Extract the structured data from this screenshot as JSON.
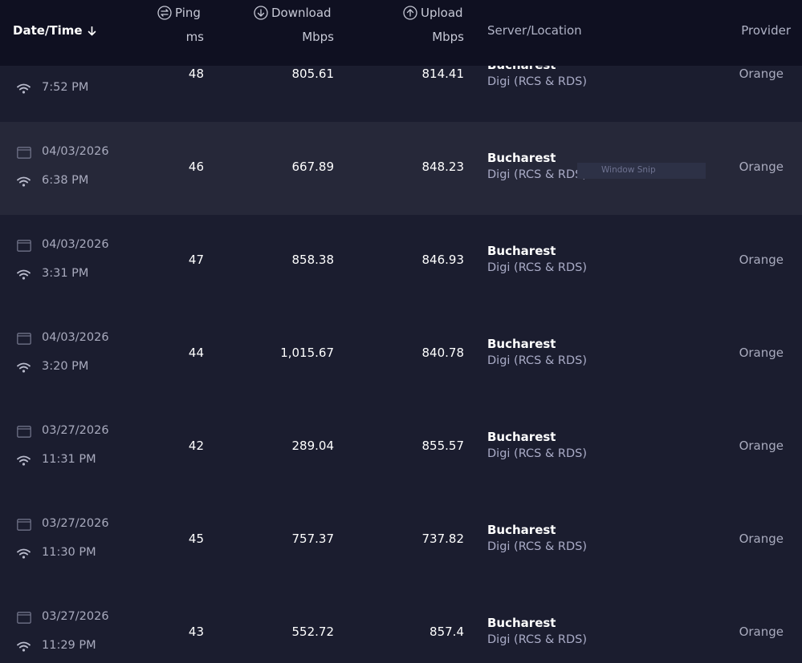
{
  "header": {
    "date_time": "Date/Time",
    "ping_label": "Ping",
    "ping_unit": "ms",
    "download_label": "Download",
    "download_unit": "Mbps",
    "upload_label": "Upload",
    "upload_unit": "Mbps",
    "server_location": "Server/Location",
    "provider": "Provider"
  },
  "rows": [
    {
      "date": "",
      "time": "7:52 PM",
      "ping": "48",
      "download": "805.61",
      "upload": "814.41",
      "city": "Bucharest",
      "isp": "Digi (RCS & RDS)",
      "provider": "Orange"
    },
    {
      "date": "04/03/2026",
      "time": "6:38 PM",
      "ping": "46",
      "download": "667.89",
      "upload": "848.23",
      "city": "Bucharest",
      "isp": "Digi (RCS & RDS)",
      "provider": "Orange"
    },
    {
      "date": "04/03/2026",
      "time": "3:31 PM",
      "ping": "47",
      "download": "858.38",
      "upload": "846.93",
      "city": "Bucharest",
      "isp": "Digi (RCS & RDS)",
      "provider": "Orange"
    },
    {
      "date": "04/03/2026",
      "time": "3:20 PM",
      "ping": "44",
      "download": "1,015.67",
      "upload": "840.78",
      "city": "Bucharest",
      "isp": "Digi (RCS & RDS)",
      "provider": "Orange"
    },
    {
      "date": "03/27/2026",
      "time": "11:31 PM",
      "ping": "42",
      "download": "289.04",
      "upload": "855.57",
      "city": "Bucharest",
      "isp": "Digi (RCS & RDS)",
      "provider": "Orange"
    },
    {
      "date": "03/27/2026",
      "time": "11:30 PM",
      "ping": "45",
      "download": "757.37",
      "upload": "737.82",
      "city": "Bucharest",
      "isp": "Digi (RCS & RDS)",
      "provider": "Orange"
    },
    {
      "date": "03/27/2026",
      "time": "11:29 PM",
      "ping": "43",
      "download": "552.72",
      "upload": "857.4",
      "city": "Bucharest",
      "isp": "Digi (RCS & RDS)",
      "provider": "Orange"
    }
  ],
  "tooltip": {
    "text": "Window Snip"
  },
  "colors": {
    "header_bg": "#0f1021",
    "row_bg": "#1b1d2f",
    "row_hover_bg": "#262839",
    "text": "#ffffff",
    "muted": "#a9abbe"
  }
}
